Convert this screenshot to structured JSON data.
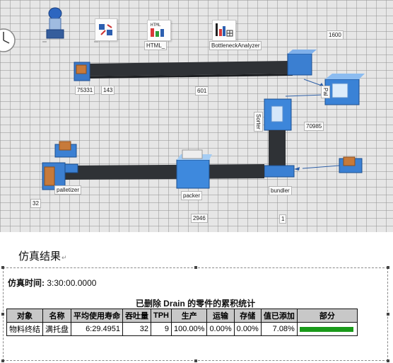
{
  "scene": {
    "labels": {
      "clock_caption": "",
      "tool_caption_1": "",
      "tool_caption_2": "HTML_",
      "tool_caption_3": "BottleneckAnalyzer",
      "counter_top_right": "1600",
      "source_left_count": "75331",
      "source_left_count2": "143",
      "conveyor_top_count": "601",
      "station_right_count": "70985",
      "palletizer": "palletizer",
      "palletizer_count": "32",
      "packer": "packer",
      "packer_count": "2946",
      "bundler": "bundler",
      "bundler_count": "1",
      "sorter_vertical": "Sorter",
      "side_vertical": "Pal"
    },
    "icons": [
      "clock-icon",
      "person-icon",
      "rotate-icon",
      "html-icon",
      "bottleneck-chart-icon"
    ]
  },
  "report": {
    "heading": "仿真结果",
    "sim_time_label": "仿真时间:",
    "sim_time_value": "3:30:00.0000",
    "table_title": "已删除 Drain 的零件的累积统计",
    "columns": [
      "对象",
      "名称",
      "平均使用寿命",
      "吞吐量",
      "TPH",
      "生产",
      "运输",
      "存储",
      "值已添加",
      "部分"
    ],
    "rows": [
      {
        "object": "物料终结",
        "name": "满托盘",
        "avg_lifetime": "6:29.4951",
        "throughput": "32",
        "tph": "9",
        "production": "100.00%",
        "transport": "0.00%",
        "storage": "0.00%",
        "value_added": "7.08%",
        "portion_fraction": 1.0
      }
    ],
    "colors": {
      "portion_bar": "#1a9a1a",
      "header_bg": "#c8c8c8"
    }
  }
}
